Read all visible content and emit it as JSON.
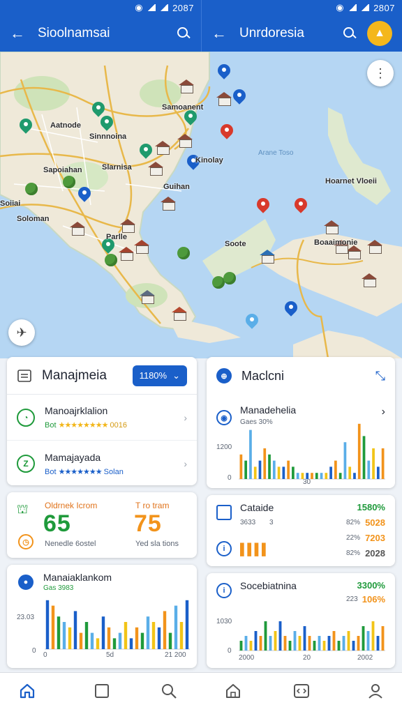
{
  "status_bar": {
    "left_time": "2087",
    "right_time": "2807"
  },
  "left_panel": {
    "title": "Sioolnamsai"
  },
  "right_panel": {
    "title": "Unrdoresia"
  },
  "map": {
    "labels": [
      "Samoanent",
      "Aatnode",
      "Sinnnoina",
      "Kinolay",
      "Sapoiahan",
      "Slarnisa",
      "Soloman",
      "Guihan",
      "Parlle",
      "Soote",
      "Parlle",
      "Soiiai",
      "Hoarnet Vloeii",
      "Boaaimonie",
      "Arane Toso"
    ],
    "icons": [
      "airplane-icon",
      "more-vert-icon"
    ]
  },
  "card_manage": {
    "title": "Manajmeia",
    "chip_label": "1180%",
    "rows": [
      {
        "name": "Manoajrklalion",
        "stars": "★★★★★★★★",
        "prefix": "Bot",
        "sub": "0016"
      },
      {
        "name": "Mamajayada",
        "stars": "★★★★★★★",
        "prefix": "Bot",
        "sub": "Solan"
      }
    ]
  },
  "card_stats": {
    "left_label": "Oldrnek Icrom",
    "left_value": "65",
    "left_caption": "Nenedle 6ostel",
    "right_label": "T ro tram",
    "right_value": "75",
    "right_caption": "Yed sla tions"
  },
  "card_chart_left": {
    "title": "Manaiaklankom",
    "subtitle": "Gas 3983",
    "y_label": "23.03",
    "y_zero": "0",
    "x_mid": "5d",
    "x_end": "21 200"
  },
  "card_mecleni": {
    "title": "Maclcni",
    "chart_title": "Manadehelia",
    "sub": "Gaes 30%",
    "y_label": "1200",
    "y_zero": "0",
    "x_label": "30"
  },
  "card_cataide": {
    "title": "Cataide",
    "top_pct": "1580%",
    "row1_left": "3633",
    "row1_mid": "3",
    "row1_pct_a": "82%",
    "row1_pct_b": "5028",
    "row2_pct_a": "22%",
    "row2_pct_b": "7203",
    "row3_pct_a": "82%",
    "row3_pct_b": "2028"
  },
  "card_soceb": {
    "title": "Socebiatnina",
    "top_pct": "3300%",
    "sub_pct_a": "223",
    "sub_pct_b": "106%",
    "y_label": "1030",
    "y_zero": "0",
    "x_start": "2000",
    "x_mid": "20",
    "x_end": "2002"
  },
  "bottom_nav": [
    "home-icon",
    "square-icon",
    "search-icon",
    "home-outline-icon",
    "code-icon",
    "profile-icon"
  ],
  "colors": {
    "primary": "#1a5fc9",
    "green": "#1f9a3b",
    "orange": "#f2931b",
    "yellow": "#f2c417",
    "lightblue": "#5aaee8"
  },
  "chart_data": [
    {
      "type": "bar",
      "title": "Manaiaklankom",
      "series": [
        {
          "name": "",
          "values": [
            9,
            8,
            6,
            5,
            4,
            7,
            3,
            5,
            3,
            2,
            6,
            4,
            2,
            3,
            5,
            2,
            4,
            3,
            6,
            5,
            4,
            7,
            3,
            8,
            5,
            9
          ]
        }
      ],
      "ylim": [
        0,
        10
      ]
    },
    {
      "type": "bar",
      "title": "Manadehelia",
      "series": [
        {
          "name": "",
          "values": [
            4,
            3,
            8,
            2,
            3,
            5,
            4,
            3,
            2,
            2,
            3,
            2,
            1,
            1,
            1,
            1,
            1,
            1,
            1,
            2,
            3,
            1,
            6,
            2,
            1,
            9,
            7,
            3,
            5,
            2,
            5
          ]
        }
      ],
      "ylim": [
        0,
        10
      ]
    },
    {
      "type": "bar",
      "title": "Socebiatnina",
      "series": [
        {
          "name": "",
          "values": [
            2,
            3,
            2,
            4,
            3,
            6,
            3,
            4,
            6,
            3,
            2,
            4,
            3,
            5,
            3,
            2,
            3,
            2,
            3,
            4,
            2,
            3,
            4,
            2,
            3,
            5,
            4,
            6,
            3,
            5
          ]
        }
      ],
      "ylim": [
        0,
        10
      ]
    }
  ]
}
